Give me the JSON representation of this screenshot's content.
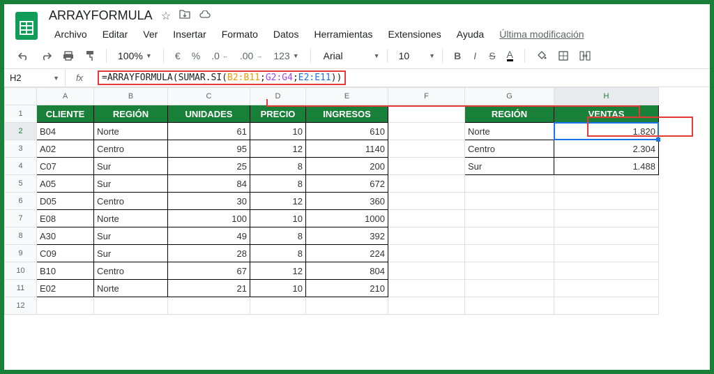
{
  "doc": {
    "title": "ARRAYFORMULA"
  },
  "menus": {
    "file": "Archivo",
    "edit": "Editar",
    "view": "Ver",
    "insert": "Insertar",
    "format": "Formato",
    "data": "Datos",
    "tools": "Herramientas",
    "extensions": "Extensiones",
    "help": "Ayuda",
    "last_mod": "Última modificación"
  },
  "toolbar": {
    "zoom": "100%",
    "currency": "€",
    "percent": "%",
    "dec_dec": ".0",
    "inc_dec": ".00",
    "more_fmt": "123",
    "font": "Arial",
    "size": "10",
    "bold": "B",
    "italic": "I",
    "strike": "S",
    "text_color": "A"
  },
  "formula_bar": {
    "name_box": "H2",
    "prefix": "=ARRAYFORMULA(SUMAR.SI(",
    "range1": "B2:B11",
    "sep1": ";",
    "range2": "G2:G4",
    "sep2": ";",
    "range3": "E2:E11",
    "suffix": "))"
  },
  "columns": [
    "A",
    "B",
    "C",
    "D",
    "E",
    "F",
    "G",
    "H"
  ],
  "row_nums": [
    "1",
    "2",
    "3",
    "4",
    "5",
    "6",
    "7",
    "8",
    "9",
    "10",
    "11",
    "12"
  ],
  "table1": {
    "headers": {
      "cliente": "CLIENTE",
      "region": "REGIÓN",
      "unidades": "UNIDADES",
      "precio": "PRECIO",
      "ingresos": "INGRESOS"
    },
    "rows": [
      {
        "cliente": "B04",
        "region": "Norte",
        "unidades": "61",
        "precio": "10",
        "ingresos": "610"
      },
      {
        "cliente": "A02",
        "region": "Centro",
        "unidades": "95",
        "precio": "12",
        "ingresos": "1140"
      },
      {
        "cliente": "C07",
        "region": "Sur",
        "unidades": "25",
        "precio": "8",
        "ingresos": "200"
      },
      {
        "cliente": "A05",
        "region": "Sur",
        "unidades": "84",
        "precio": "8",
        "ingresos": "672"
      },
      {
        "cliente": "D05",
        "region": "Centro",
        "unidades": "30",
        "precio": "12",
        "ingresos": "360"
      },
      {
        "cliente": "E08",
        "region": "Norte",
        "unidades": "100",
        "precio": "10",
        "ingresos": "1000"
      },
      {
        "cliente": "A30",
        "region": "Sur",
        "unidades": "49",
        "precio": "8",
        "ingresos": "392"
      },
      {
        "cliente": "C09",
        "region": "Sur",
        "unidades": "28",
        "precio": "8",
        "ingresos": "224"
      },
      {
        "cliente": "B10",
        "region": "Centro",
        "unidades": "67",
        "precio": "12",
        "ingresos": "804"
      },
      {
        "cliente": "E02",
        "region": "Norte",
        "unidades": "21",
        "precio": "10",
        "ingresos": "210"
      }
    ]
  },
  "table2": {
    "headers": {
      "region": "REGIÓN",
      "ventas": "VENTAS"
    },
    "rows": [
      {
        "region": "Norte",
        "ventas": "1.820"
      },
      {
        "region": "Centro",
        "ventas": "2.304"
      },
      {
        "region": "Sur",
        "ventas": "1.488"
      }
    ]
  }
}
